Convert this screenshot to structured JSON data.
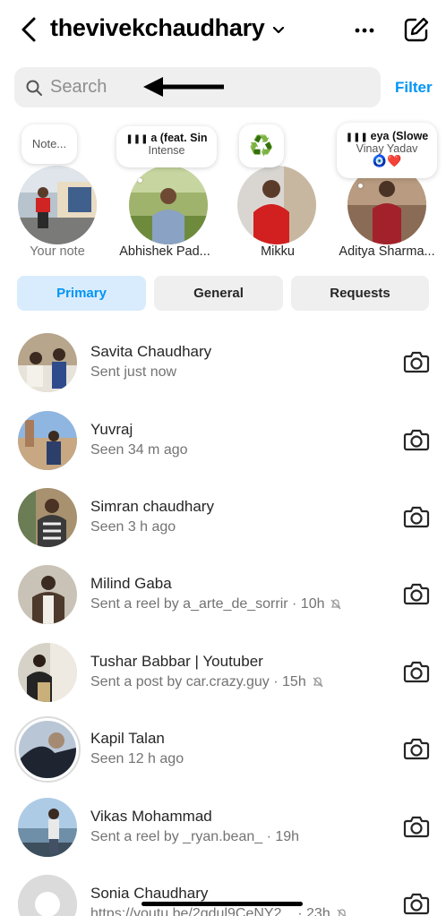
{
  "header": {
    "username": "thevivekchaudhary"
  },
  "search": {
    "placeholder": "Search",
    "filter_label": "Filter"
  },
  "notes": [
    {
      "label": "Your note",
      "bubble_text": "Note..."
    },
    {
      "label": "Abhishek Pad...",
      "bubble_title": "a (feat. Sin",
      "bubble_sub": "Intense"
    },
    {
      "label": "Mikku",
      "bubble_emoji": "♻️"
    },
    {
      "label": "Aditya Sharma...",
      "bubble_title": "eya (Slowe",
      "bubble_sub": "Vinay Yadav",
      "bubble_emoji": "🧿❤️"
    }
  ],
  "tabs": [
    {
      "label": "Primary",
      "active": true
    },
    {
      "label": "General",
      "active": false
    },
    {
      "label": "Requests",
      "active": false
    }
  ],
  "chats": [
    {
      "name": "Savita Chaudhary",
      "status": "Sent just now",
      "muted": false
    },
    {
      "name": "Yuvraj",
      "status": "Seen 34 m ago",
      "muted": false
    },
    {
      "name": "Simran chaudhary",
      "status": "Seen 3 h ago",
      "muted": false
    },
    {
      "name": "Milind Gaba",
      "status": "Sent a reel by a_arte_de_sorrir · 10h",
      "muted": true
    },
    {
      "name": "Tushar Babbar | Youtuber",
      "status": "Sent a post by car.crazy.guy · 15h",
      "muted": true
    },
    {
      "name": "Kapil Talan",
      "status": "Seen 12 h ago",
      "muted": false
    },
    {
      "name": "Vikas Mohammad",
      "status": "Sent a reel by _ryan.bean_ · 19h",
      "muted": false
    },
    {
      "name": "Sonia Chaudhary",
      "status": "https://youtu.be/2gdul9CeNY2... · 23h",
      "muted": true
    }
  ],
  "colors": {
    "accent": "#0095f6",
    "active_tab_bg": "#d9ecfd",
    "muted_text": "#737373"
  }
}
